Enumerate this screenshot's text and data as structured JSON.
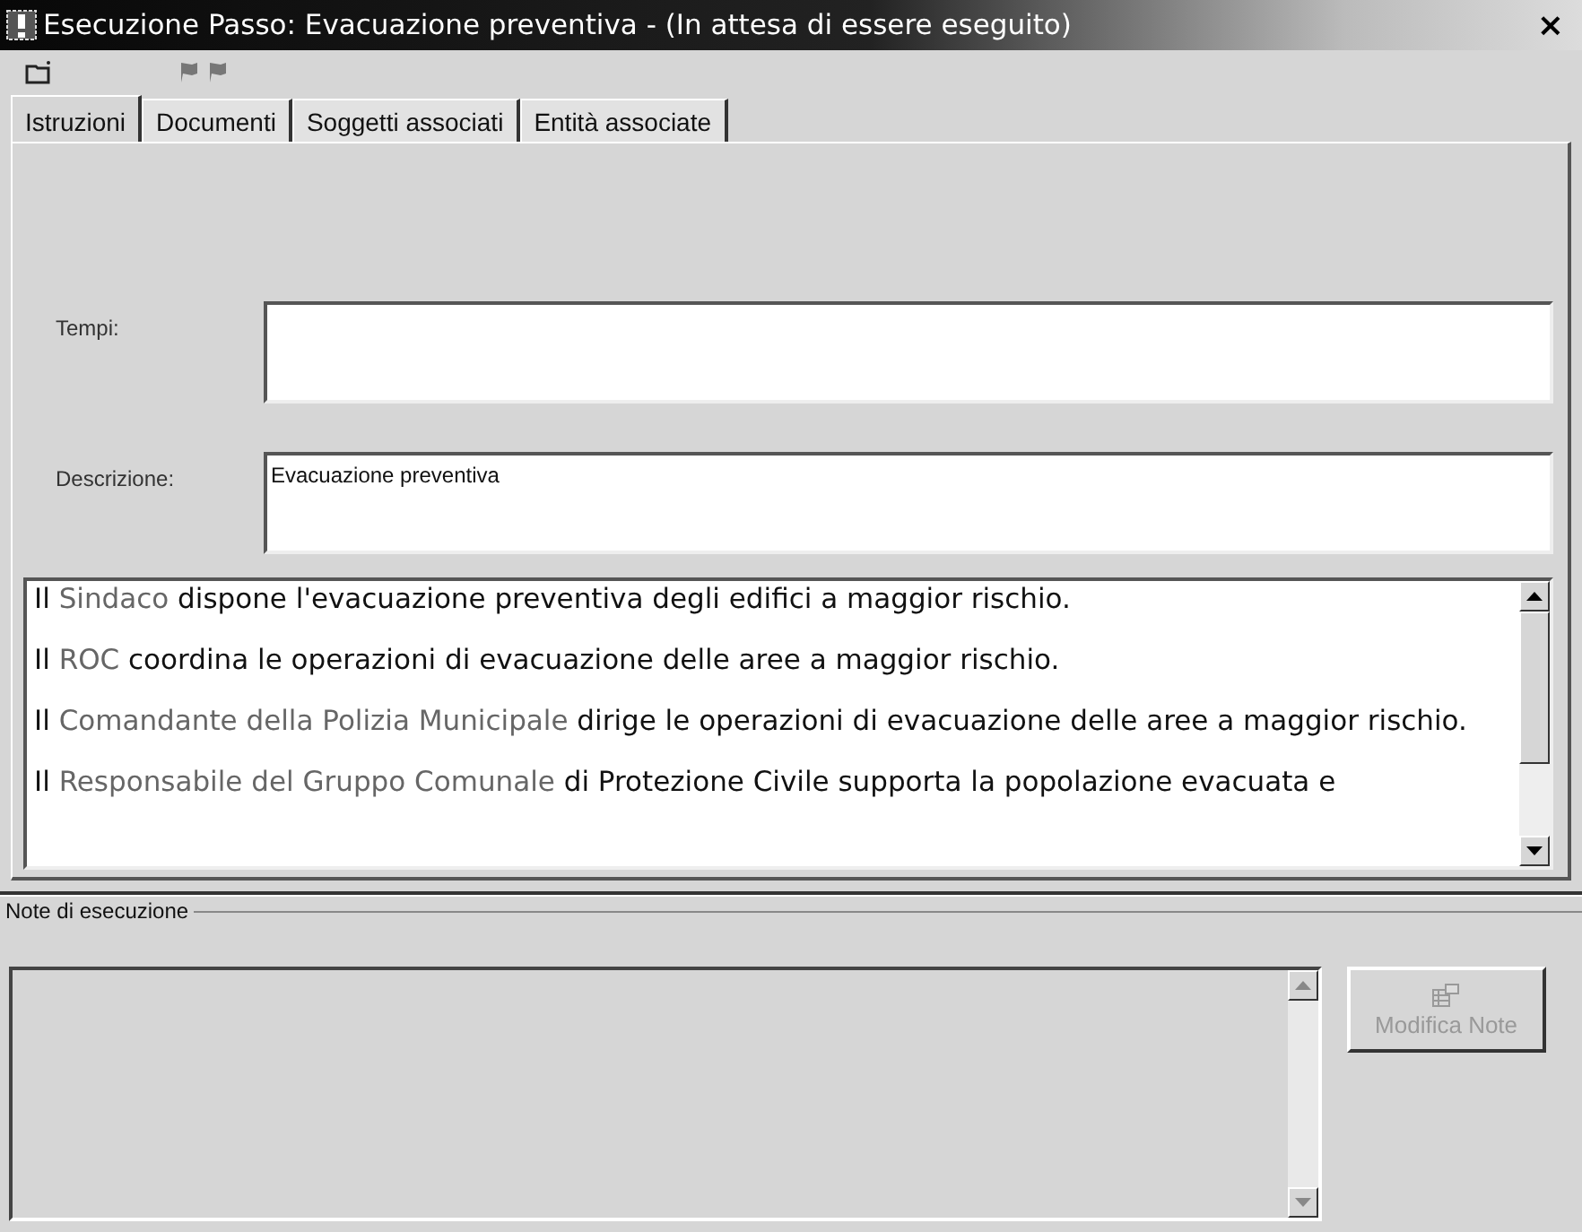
{
  "window": {
    "title": "Esecuzione Passo: Evacuazione preventiva - (In attesa di essere eseguito)",
    "close": "×"
  },
  "tabs": [
    {
      "label": "Istruzioni",
      "selected": true
    },
    {
      "label": "Documenti",
      "selected": false
    },
    {
      "label": "Soggetti associati",
      "selected": false
    },
    {
      "label": "Entità associate",
      "selected": false
    }
  ],
  "fields": [
    {
      "label": "Tempi:"
    },
    {
      "label": "Descrizione:",
      "value": "Evacuazione preventiva"
    }
  ],
  "instructions": [
    [
      {
        "text": "Il ",
        "kind": "plain"
      },
      {
        "text": "Sindaco",
        "kind": "role"
      },
      {
        "text": " dispone l'evacuazione preventiva degli edifici a maggior rischio.",
        "kind": "plain"
      }
    ],
    [
      {
        "text": "Il ",
        "kind": "plain"
      },
      {
        "text": "ROC",
        "kind": "role"
      },
      {
        "text": " coordina le operazioni di evacuazione delle aree a maggior rischio.",
        "kind": "plain"
      }
    ],
    [
      {
        "text": "Il ",
        "kind": "plain"
      },
      {
        "text": "Comandante della Polizia Municipale",
        "kind": "role"
      },
      {
        "text": " dirige le operazioni di evacuazione delle aree a maggior rischio.",
        "kind": "plain"
      }
    ],
    [
      {
        "text": "Il ",
        "kind": "plain"
      },
      {
        "text": "Responsabile del Gruppo Comunale",
        "kind": "role"
      },
      {
        "text": " di Protezione Civile supporta la popolazione evacuata e",
        "kind": "plain"
      }
    ]
  ],
  "notes": {
    "legend": "Note di esecuzione",
    "button": {
      "label": "Modifica Note",
      "disabled": true
    }
  }
}
